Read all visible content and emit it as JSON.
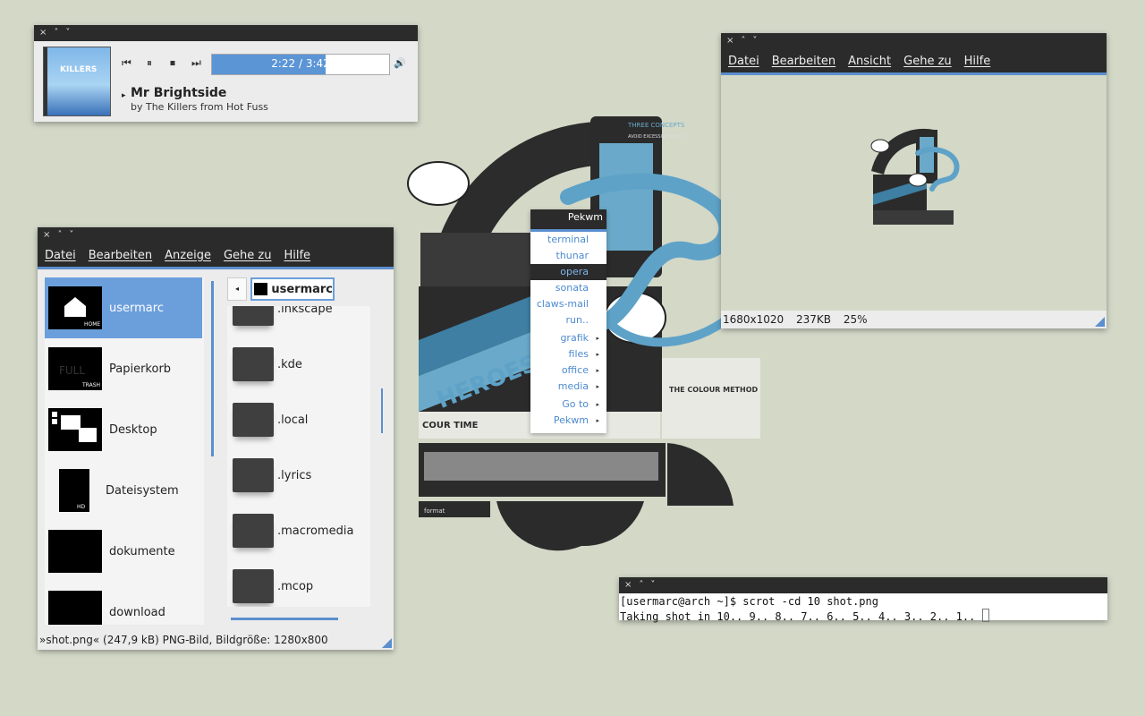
{
  "titlebar_buttons": {
    "close": "×",
    "maximize": "˄",
    "minimize": "˅"
  },
  "player": {
    "time": "2:22 / 3:42",
    "progress_fraction": 0.64,
    "title": "Mr Brightside",
    "subtitle": "by The Killers from Hot Fuss",
    "cover_text": "KILLERS",
    "controls": {
      "prev": "⏮",
      "pause": "⏸",
      "stop": "⏹",
      "next": "⏭",
      "volume": "🔊"
    },
    "expander": "▸"
  },
  "file_manager": {
    "menu": [
      "Datei",
      "Bearbeiten",
      "Anzeige",
      "Gehe zu",
      "Hilfe"
    ],
    "places": [
      {
        "label": "usermarc",
        "icon": "home-folder-icon",
        "selected": true
      },
      {
        "label": "Papierkorb",
        "icon": "trash-icon",
        "selected": false
      },
      {
        "label": "Desktop",
        "icon": "desktop-icon",
        "selected": false
      },
      {
        "label": "Dateisystem",
        "icon": "harddisk-icon",
        "selected": false
      },
      {
        "label": "dokumente",
        "icon": "folder-icon",
        "selected": false
      },
      {
        "label": "download",
        "icon": "folder-icon",
        "selected": false
      }
    ],
    "path": "usermarc",
    "back": "◂",
    "files": [
      ".inkscape",
      ".kde",
      ".local",
      ".lyrics",
      ".macromedia",
      ".mcop"
    ],
    "status": "»shot.png« (247,9 kB) PNG-Bild, Bildgröße: 1280x800",
    "icon_labels": {
      "home": "HOME",
      "trash": "TRASH",
      "full": "FULL",
      "hd": "HD"
    }
  },
  "image_viewer": {
    "menu": [
      "Datei",
      "Bearbeiten",
      "Ansicht",
      "Gehe zu",
      "Hilfe"
    ],
    "status": "1680x1020 237KB 25%"
  },
  "pekwm_menu": {
    "title": "Pekwm",
    "items": [
      {
        "label": "terminal",
        "submenu": false,
        "selected": false
      },
      {
        "label": "thunar",
        "submenu": false,
        "selected": false
      },
      {
        "label": "opera",
        "submenu": false,
        "selected": true
      },
      {
        "label": "sonata",
        "submenu": false,
        "selected": false
      },
      {
        "label": "claws-mail",
        "submenu": false,
        "selected": false
      },
      {
        "label": "run..",
        "submenu": false,
        "selected": false
      },
      {
        "label": "grafik",
        "submenu": true,
        "selected": false
      },
      {
        "label": "files",
        "submenu": true,
        "selected": false
      },
      {
        "label": "office",
        "submenu": true,
        "selected": false
      },
      {
        "label": "media",
        "submenu": true,
        "selected": false
      },
      {
        "label": "Go to",
        "submenu": true,
        "selected": false
      },
      {
        "label": "Pekwm",
        "submenu": true,
        "selected": false
      }
    ],
    "submenu_arrow": "▸"
  },
  "terminal": {
    "line1": "[usermarc@arch ~]$ scrot -cd 10 shot.png",
    "line2": "Taking shot in 10.. 9.. 8.. 7.. 6.. 5.. 4.. 3.. 2.. 1.. "
  },
  "colors": {
    "accent": "#5b8fcf",
    "selection": "#6b9fdc",
    "titlebar": "#2b2b2b",
    "desktop": "#d3d8c7"
  },
  "wallpaper": {
    "badge_main": "THREE CONCEPTS",
    "badge_sub": "AVOID EXCESSIVE SHOCK",
    "blue_letters": "HEROES",
    "poster_label": "THE COLOUR METHOD",
    "footer_left": "COUR TIME",
    "brand": "format"
  }
}
